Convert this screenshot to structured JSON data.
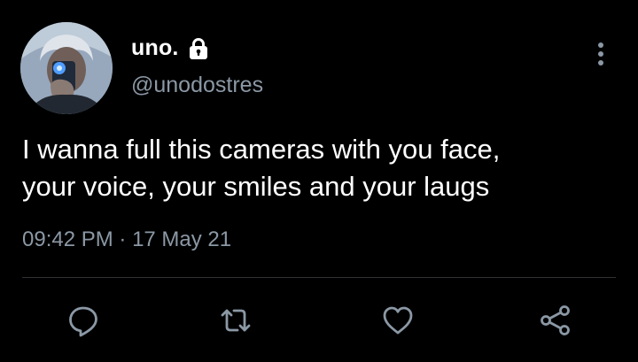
{
  "tweet": {
    "display_name": "uno.",
    "handle": "@unodostres",
    "text": "I wanna full this cameras with you face,\nyour voice, your smiles and your laugs",
    "time": "09:42 PM",
    "separator": " · ",
    "date": "17 May 21",
    "icons": {
      "lock": "lock-icon",
      "more": "more-vertical-icon",
      "reply": "reply-icon",
      "retweet": "retweet-icon",
      "like": "heart-icon",
      "share": "share-icon"
    },
    "colors": {
      "background": "#000000",
      "primary_text": "#ffffff",
      "secondary_text": "#8b98a5",
      "divider": "#2f3336"
    }
  }
}
